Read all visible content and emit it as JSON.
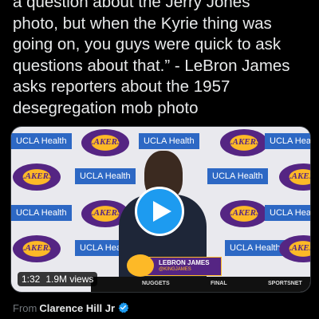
{
  "tweet": {
    "lines": [
      "a question about the Jerry Jones",
      "photo, but when the Kyrie thing was",
      "going on, you guys were quick to ask",
      "questions about that.” - LeBron James",
      "asks reporters about the 1957",
      "desegregation  mob photo"
    ]
  },
  "video": {
    "backdrop_logos": {
      "ucla_health": "UCLA Health",
      "lakers": "LAKERS"
    },
    "lower_third": {
      "name": "LEBRON JAMES",
      "handle": "@KINGJAMES"
    },
    "scorebar": {
      "team": "NUGGETS",
      "status": "FINAL",
      "network": "SPORTSNET"
    },
    "duration": "1:32",
    "views": "1.9M views",
    "play_icon": "play-icon"
  },
  "attribution": {
    "prefix": "From",
    "author": "Clarence Hill Jr",
    "badge_icon": "verified-badge-icon",
    "badge_color": "#1d9bf0"
  },
  "colors": {
    "background": "#000000",
    "text": "#e7e9ea",
    "muted": "#71767b",
    "accent": "#1d9bf0"
  }
}
